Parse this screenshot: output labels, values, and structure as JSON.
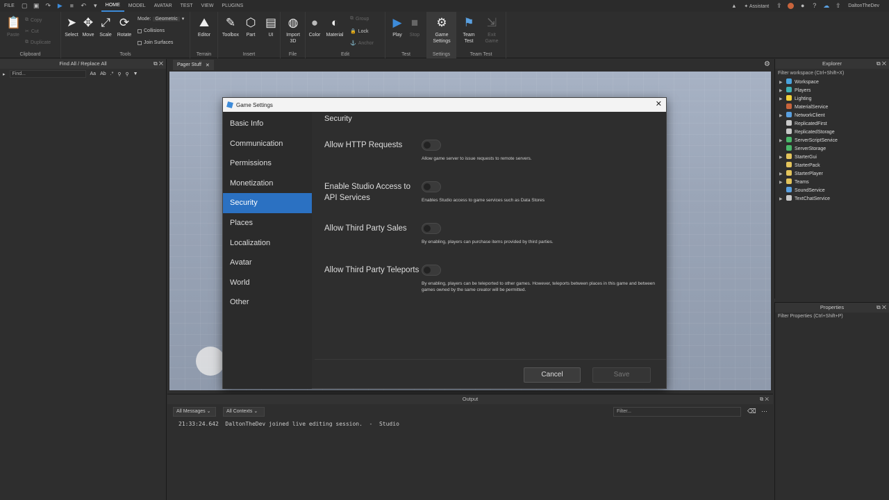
{
  "menubar": {
    "file": "FILE",
    "tabs": [
      "HOME",
      "MODEL",
      "AVATAR",
      "TEST",
      "VIEW",
      "PLUGINS"
    ],
    "active": "HOME",
    "assistant": "Assistant",
    "username": "DaltonTheDev"
  },
  "ribbon": {
    "clipboard": {
      "paste": "Paste",
      "copy": "Copy",
      "cut": "Cut",
      "duplicate": "Duplicate",
      "label": "Clipboard"
    },
    "tools": {
      "select": "Select",
      "move": "Move",
      "scale": "Scale",
      "rotate": "Rotate",
      "mode_label": "Mode:",
      "mode_value": "Geometric",
      "collisions": "Collisions",
      "join_surfaces": "Join Surfaces",
      "label": "Tools"
    },
    "terrain": {
      "editor": "Editor",
      "label": "Terrain"
    },
    "insert": {
      "toolbox": "Toolbox",
      "part": "Part",
      "ui": "UI",
      "label": "Insert"
    },
    "file": {
      "import3d": "Import 3D",
      "label": "File"
    },
    "edit": {
      "color": "Color",
      "material": "Material",
      "group": "Group",
      "lock": "Lock",
      "anchor": "Anchor",
      "label": "Edit"
    },
    "test": {
      "play": "Play",
      "stop": "Stop",
      "label": "Test"
    },
    "settings": {
      "game_settings": "Game Settings",
      "label": "Settings"
    },
    "team_test": {
      "team_test": "Team Test",
      "exit_game": "Exit Game",
      "label": "Team Test"
    }
  },
  "find_panel": {
    "title": "Find All / Replace All",
    "placeholder": "Find..."
  },
  "doc_tab": {
    "label": "Pager Stuff"
  },
  "dialog": {
    "title": "Game Settings",
    "nav": [
      "Basic Info",
      "Communication",
      "Permissions",
      "Monetization",
      "Security",
      "Places",
      "Localization",
      "Avatar",
      "World",
      "Other"
    ],
    "active_nav": "Security",
    "section_title": "Security",
    "settings": [
      {
        "label": "Allow HTTP Requests",
        "enabled": false,
        "description": "Allow game server to issue requests to remote servers."
      },
      {
        "label": "Enable Studio Access to API Services",
        "enabled": false,
        "description": "Enables Studio access to game services such as Data Stores"
      },
      {
        "label": "Allow Third Party Sales",
        "enabled": false,
        "description": "By enabling, players can purchase items provided by third parties."
      },
      {
        "label": "Allow Third Party Teleports",
        "enabled": false,
        "description": "By enabling, players can be teleported to other games. However, teleports between places in this game and between games owned by the same creator will be permitted."
      }
    ],
    "cancel": "Cancel",
    "save": "Save"
  },
  "output": {
    "title": "Output",
    "filter_messages": "All Messages",
    "filter_contexts": "All Contexts",
    "filter_placeholder": "Filter...",
    "line": "21:33:24.642  DaltonTheDev joined live editing session.  -  Studio"
  },
  "explorer": {
    "title": "Explorer",
    "filter": "Filter workspace (Ctrl+Shift+X)",
    "items": [
      {
        "name": "Workspace",
        "color": "#4aa3df",
        "expand": true
      },
      {
        "name": "Players",
        "color": "#3fb0b5",
        "expand": true
      },
      {
        "name": "Lighting",
        "color": "#f2d13a",
        "expand": true
      },
      {
        "name": "MaterialService",
        "color": "#c8643c",
        "expand": false
      },
      {
        "name": "NetworkClient",
        "color": "#5aa0e0",
        "expand": true
      },
      {
        "name": "ReplicatedFirst",
        "color": "#c9c9c9",
        "expand": false
      },
      {
        "name": "ReplicatedStorage",
        "color": "#c9c9c9",
        "expand": false
      },
      {
        "name": "ServerScriptService",
        "color": "#4ab86a",
        "expand": true
      },
      {
        "name": "ServerStorage",
        "color": "#4ab86a",
        "expand": false
      },
      {
        "name": "StarterGui",
        "color": "#e3c45c",
        "expand": true
      },
      {
        "name": "StarterPack",
        "color": "#e3c45c",
        "expand": false
      },
      {
        "name": "StarterPlayer",
        "color": "#e3c45c",
        "expand": true
      },
      {
        "name": "Teams",
        "color": "#e3c45c",
        "expand": true
      },
      {
        "name": "SoundService",
        "color": "#5aa0e0",
        "expand": false
      },
      {
        "name": "TextChatService",
        "color": "#c9c9c9",
        "expand": true
      }
    ]
  },
  "properties": {
    "title": "Properties",
    "filter": "Filter Properties (Ctrl+Shift+P)"
  }
}
